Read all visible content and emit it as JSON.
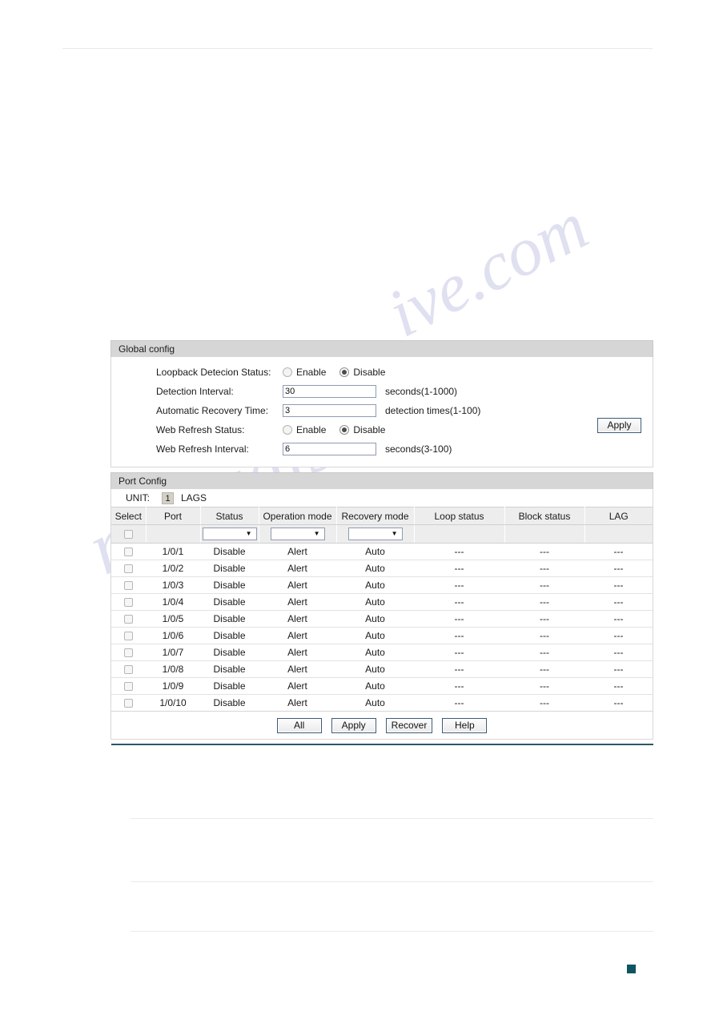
{
  "page": {
    "marker_color": "#0d5560",
    "accent_rule_color": "#2d5566",
    "watermark_a": "ive.com",
    "watermark_b": "manualshive"
  },
  "global_config": {
    "title": "Global config",
    "rows": [
      {
        "label": "Loopback Detecion Status:",
        "type": "radio",
        "options": [
          "Enable",
          "Disable"
        ],
        "selected": "Disable"
      },
      {
        "label": "Detection Interval:",
        "type": "text",
        "value": "30",
        "placeholder": "",
        "hint": "seconds(1-1000)"
      },
      {
        "label": "Automatic Recovery Time:",
        "type": "text",
        "value": "3",
        "placeholder": "",
        "hint": "detection times(1-100)"
      },
      {
        "label": "Web Refresh Status:",
        "type": "radio",
        "options": [
          "Enable",
          "Disable"
        ],
        "selected": "Disable"
      },
      {
        "label": "Web Refresh Interval:",
        "type": "text",
        "value": "6",
        "placeholder": "",
        "hint": "seconds(3-100)"
      }
    ],
    "apply_label": "Apply"
  },
  "port_config": {
    "title": "Port Config",
    "unit_label": "UNIT:",
    "unit_value": "1",
    "lags_label": "LAGS",
    "columns": [
      "Select",
      "Port",
      "Status",
      "Operation mode",
      "Recovery mode",
      "Loop status",
      "Block status",
      "LAG"
    ],
    "filter": {
      "status_value": "",
      "operation_mode_value": "",
      "recovery_mode_value": "",
      "arrow": "▼"
    },
    "rows": [
      {
        "port": "1/0/1",
        "status": "Disable",
        "operation_mode": "Alert",
        "recovery_mode": "Auto",
        "loop_status": "---",
        "block_status": "---",
        "lag": "---"
      },
      {
        "port": "1/0/2",
        "status": "Disable",
        "operation_mode": "Alert",
        "recovery_mode": "Auto",
        "loop_status": "---",
        "block_status": "---",
        "lag": "---"
      },
      {
        "port": "1/0/3",
        "status": "Disable",
        "operation_mode": "Alert",
        "recovery_mode": "Auto",
        "loop_status": "---",
        "block_status": "---",
        "lag": "---"
      },
      {
        "port": "1/0/4",
        "status": "Disable",
        "operation_mode": "Alert",
        "recovery_mode": "Auto",
        "loop_status": "---",
        "block_status": "---",
        "lag": "---"
      },
      {
        "port": "1/0/5",
        "status": "Disable",
        "operation_mode": "Alert",
        "recovery_mode": "Auto",
        "loop_status": "---",
        "block_status": "---",
        "lag": "---"
      },
      {
        "port": "1/0/6",
        "status": "Disable",
        "operation_mode": "Alert",
        "recovery_mode": "Auto",
        "loop_status": "---",
        "block_status": "---",
        "lag": "---"
      },
      {
        "port": "1/0/7",
        "status": "Disable",
        "operation_mode": "Alert",
        "recovery_mode": "Auto",
        "loop_status": "---",
        "block_status": "---",
        "lag": "---"
      },
      {
        "port": "1/0/8",
        "status": "Disable",
        "operation_mode": "Alert",
        "recovery_mode": "Auto",
        "loop_status": "---",
        "block_status": "---",
        "lag": "---"
      },
      {
        "port": "1/0/9",
        "status": "Disable",
        "operation_mode": "Alert",
        "recovery_mode": "Auto",
        "loop_status": "---",
        "block_status": "---",
        "lag": "---"
      },
      {
        "port": "1/0/10",
        "status": "Disable",
        "operation_mode": "Alert",
        "recovery_mode": "Auto",
        "loop_status": "---",
        "block_status": "---",
        "lag": "---"
      }
    ],
    "buttons": [
      "All",
      "Apply",
      "Recover",
      "Help"
    ]
  }
}
